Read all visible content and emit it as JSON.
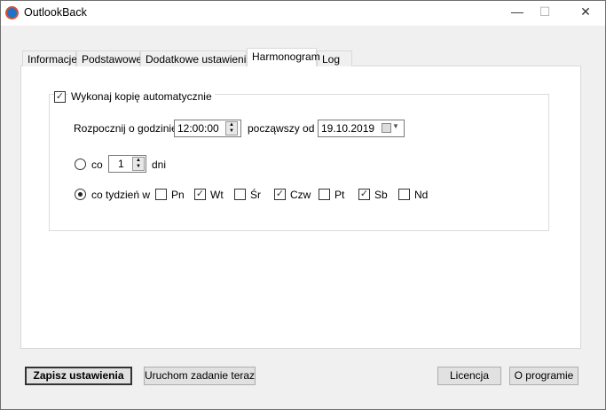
{
  "window": {
    "title": "OutlookBack",
    "minimize": "—",
    "maximize": "☐",
    "close": "✕"
  },
  "tabs": [
    {
      "label": "Informacje"
    },
    {
      "label": "Podstawowe"
    },
    {
      "label": "Dodatkowe ustawienia"
    },
    {
      "label": "Harmonogram"
    },
    {
      "label": "Log"
    }
  ],
  "schedule": {
    "auto_label": "Wykonaj kopię automatycznie",
    "auto_checked": true,
    "start_label": "Rozpocznij o godzinie",
    "time": "12:00:00",
    "from_label": "począwszy od",
    "date": "19.10.2019",
    "every_label": "co",
    "every_value": "1",
    "days_label": "dni",
    "weekly_label": "co tydzień w",
    "days": [
      {
        "label": "Pn",
        "checked": false
      },
      {
        "label": "Wt",
        "checked": true
      },
      {
        "label": "Śr",
        "checked": false
      },
      {
        "label": "Czw",
        "checked": true
      },
      {
        "label": "Pt",
        "checked": false
      },
      {
        "label": "Sb",
        "checked": true
      },
      {
        "label": "Nd",
        "checked": false
      }
    ]
  },
  "buttons": {
    "save": "Zapisz ustawienia",
    "run": "Uruchom zadanie teraz",
    "license": "Licencja",
    "about": "O programie"
  }
}
